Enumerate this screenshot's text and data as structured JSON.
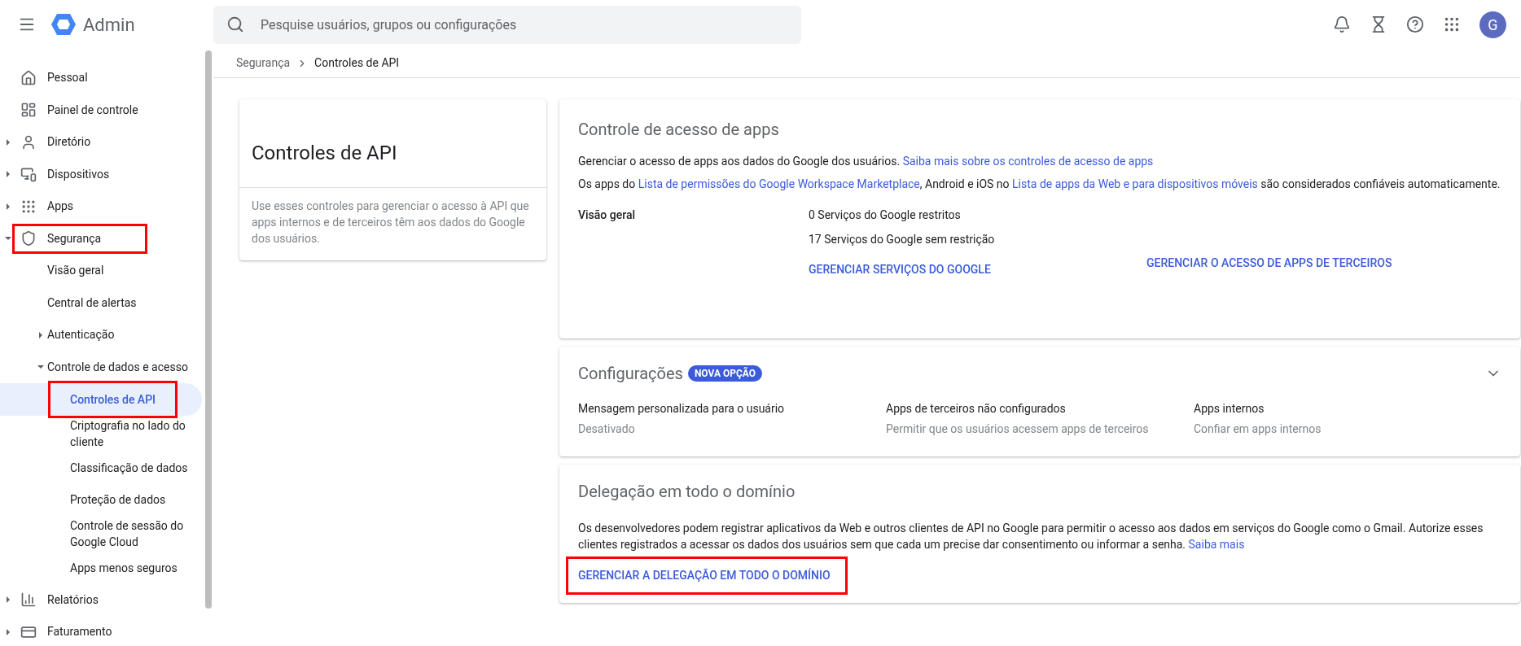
{
  "topbar": {
    "product": "Admin",
    "search": {
      "placeholder": "Pesquise usuários, grupos ou configurações"
    },
    "avatar": "G"
  },
  "sidebar": {
    "items": [
      {
        "label": "Pessoal",
        "kind": "home",
        "selected": false,
        "highlighted": false
      },
      {
        "label": "Painel de controle",
        "kind": "dashboard",
        "selected": false,
        "highlighted": false
      },
      {
        "label": "Diretório",
        "kind": "person",
        "expanded": false,
        "selected": false,
        "highlighted": false
      },
      {
        "label": "Dispositivos",
        "kind": "devices",
        "expanded": false,
        "selected": false,
        "highlighted": false
      },
      {
        "label": "Apps",
        "kind": "apps",
        "expanded": false,
        "selected": false,
        "highlighted": false
      },
      {
        "label": "Segurança",
        "kind": "shield",
        "expanded": true,
        "selected": false,
        "highlighted": true,
        "children": [
          {
            "label": "Visão geral",
            "selected": false,
            "highlighted": false
          },
          {
            "label": "Central de alertas",
            "selected": false,
            "highlighted": false
          },
          {
            "label": "Autenticação",
            "expanded": false,
            "selected": false,
            "highlighted": false
          },
          {
            "label": "Controle de dados e acesso",
            "expanded": true,
            "selected": false,
            "highlighted": false,
            "children": [
              {
                "label": "Controles de API",
                "selected": true,
                "highlighted": true
              },
              {
                "label": "Criptografia no lado do cliente",
                "selected": false,
                "highlighted": false
              },
              {
                "label": "Classificação de dados",
                "selected": false,
                "highlighted": false
              },
              {
                "label": "Proteção de dados",
                "selected": false,
                "highlighted": false
              },
              {
                "label": "Controle de sessão do Google Cloud",
                "selected": false,
                "highlighted": false
              },
              {
                "label": "Apps menos seguros",
                "selected": false,
                "highlighted": false
              }
            ]
          }
        ]
      },
      {
        "label": "Relatórios",
        "kind": "chart",
        "expanded": false,
        "selected": false,
        "highlighted": false
      },
      {
        "label": "Faturamento",
        "kind": "card",
        "expanded": false,
        "selected": false,
        "highlighted": false
      }
    ]
  },
  "breadcrumb": [
    "Segurança",
    "Controles de API"
  ],
  "intro_card": {
    "title": "Controles de API",
    "description": "Use esses controles para gerenciar o acesso à API que apps internos e de terceiros têm aos dados do Google dos usuários."
  },
  "app_access_card": {
    "title": "Controle de acesso de apps",
    "line_1": [
      {
        "kind": "text",
        "text": "Gerenciar o acesso de apps aos dados do Google dos usuários. "
      },
      {
        "kind": "link",
        "text": "Saiba mais sobre os controles de acesso de apps"
      }
    ],
    "line_2": [
      {
        "kind": "text",
        "text": "Os apps do "
      },
      {
        "kind": "link",
        "text": "Lista de permissões do Google Workspace Marketplace"
      },
      {
        "kind": "text",
        "text": ", Android e iOS no "
      },
      {
        "kind": "link",
        "text": "Lista de apps da Web e para dispositivos móveis"
      },
      {
        "kind": "text",
        "text": " são considerados confiáveis automaticamente."
      }
    ],
    "overview_label": "Visão geral",
    "stats": [
      "0 Serviços do Google restritos",
      "17 Serviços do Google sem restrição"
    ],
    "actions": [
      "GERENCIAR SERVIÇOS DO GOOGLE",
      "GERENCIAR O ACESSO DE APPS DE TERCEIROS"
    ]
  },
  "settings_card": {
    "title": "Configurações",
    "badge": "NOVA OPÇÃO",
    "expanded": false,
    "settings": [
      {
        "name": "Mensagem personalizada para o usuário",
        "value": "Desativado"
      },
      {
        "name": "Apps de terceiros não configurados",
        "value": "Permitir que os usuários acessem apps de terceiros"
      },
      {
        "name": "Apps internos",
        "value": "Confiar em apps internos"
      }
    ]
  },
  "delegation_card": {
    "title": "Delegação em todo o domínio",
    "description": "Os desenvolvedores podem registrar aplicativos da Web e outros clientes de API no Google para permitir o acesso aos dados em serviços do Google como o Gmail. Autorize esses clientes registrados a acessar os dados dos usuários sem que cada um precise dar consentimento ou informar a senha.",
    "link": "Saiba mais",
    "action": {
      "label": "GERENCIAR A DELEGAÇÃO EM TODO O DOMÍNIO",
      "highlighted": true
    }
  }
}
